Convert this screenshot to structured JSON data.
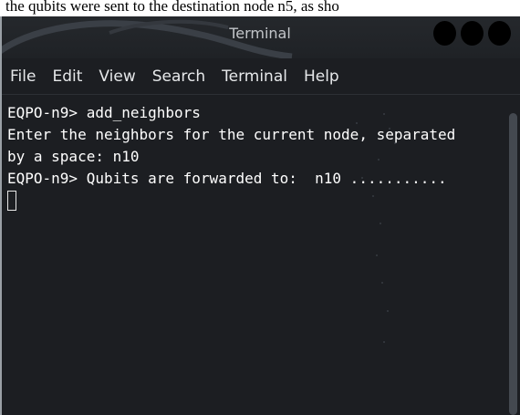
{
  "document": {
    "snippet": "the qubits were sent to the destination node n5, as sho"
  },
  "window": {
    "title": "Terminal"
  },
  "menu": {
    "items": [
      "File",
      "Edit",
      "View",
      "Search",
      "Terminal",
      "Help"
    ]
  },
  "terminal": {
    "lines": [
      "EQPO-n9> add_neighbors",
      "Enter the neighbors for the current node, separated",
      "by a space: n10",
      "EQPO-n9> Qubits are forwarded to:  n10 ..........."
    ]
  },
  "colors": {
    "window_bg": "#1c1e22",
    "text": "#ffffff",
    "menu_text": "#e6e8ea"
  },
  "icons": {
    "window_controls": [
      "minimize-icon",
      "maximize-icon",
      "close-icon"
    ]
  }
}
